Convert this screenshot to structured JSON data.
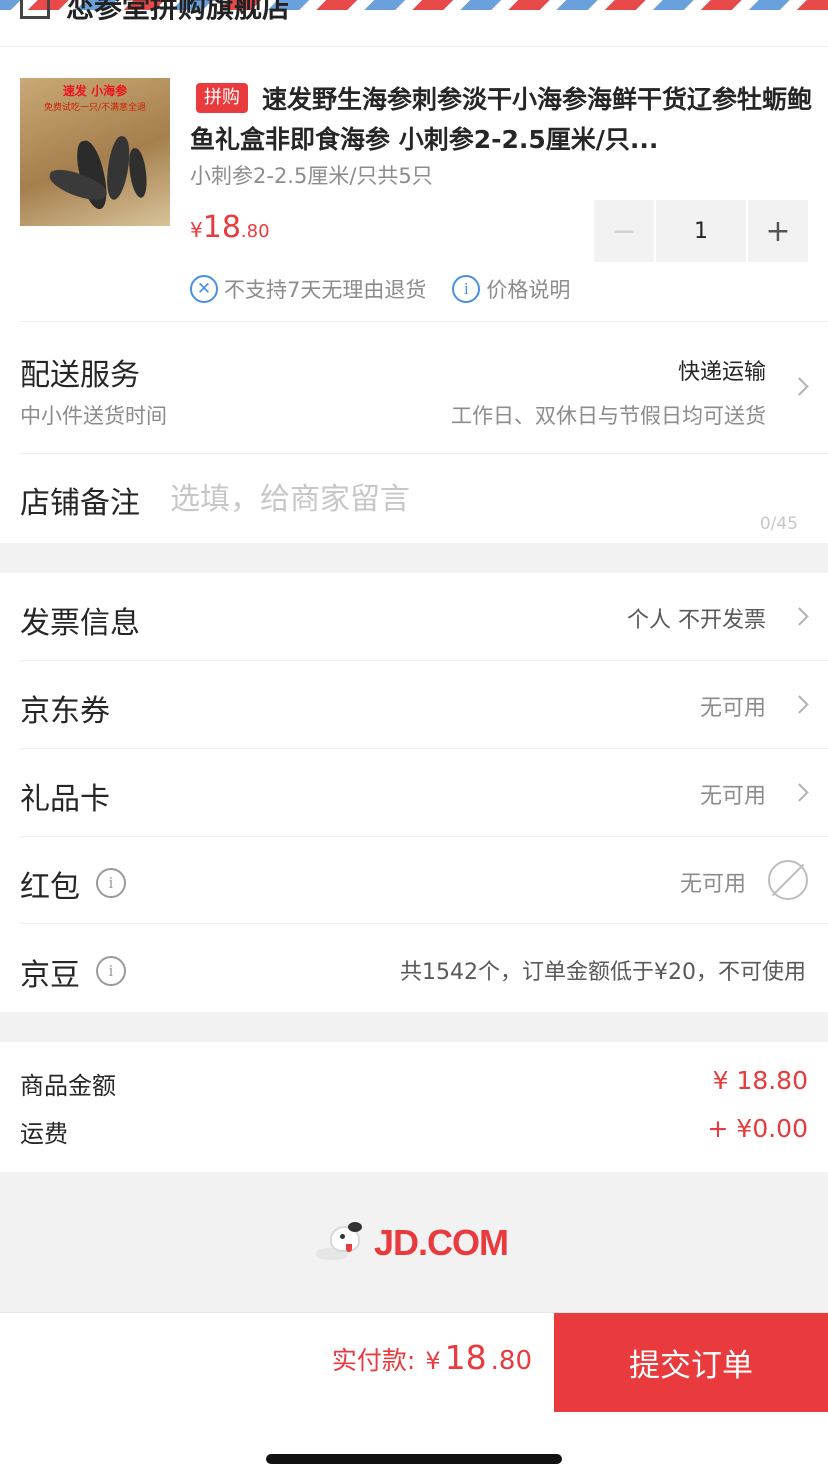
{
  "shop": {
    "name": "恋参堂拼购旗舰店"
  },
  "product": {
    "image_text": "速发 小海参",
    "image_subtext": "免费试吃一只/不满意全退",
    "badge": "拼购",
    "title": "速发野生海参刺参淡干小海参海鲜干货辽参牡蛎鲍鱼礼盒非即食海参 小刺参2-2.5厘米/只...",
    "spec": "小刺参2-2.5厘米/只共5只",
    "price": {
      "currency": "¥",
      "int": "18",
      "dec": ".80"
    },
    "quantity": "1",
    "minus_label": "−",
    "plus_label": "+",
    "no_return": "不支持7天无理由退货",
    "price_info": "价格说明"
  },
  "delivery": {
    "title": "配送服务",
    "subtitle": "中小件送货时间",
    "method": "快递运输",
    "schedule": "工作日、双休日与节假日均可送货"
  },
  "remark": {
    "label": "店铺备注",
    "placeholder": "选填，给商家留言",
    "counter": "0/45"
  },
  "options": [
    {
      "label": "发票信息",
      "value": "个人 不开发票"
    },
    {
      "label": "京东券",
      "value": "无可用"
    },
    {
      "label": "礼品卡",
      "value": "无可用"
    },
    {
      "label": "红包",
      "value": "无可用"
    },
    {
      "label": "京豆",
      "value": "共1542个，订单金额低于¥20，不可使用"
    }
  ],
  "summary": {
    "goods_label": "商品金额",
    "goods_value": "¥ 18.80",
    "freight_label": "运费",
    "freight_value": "+ ¥0.00"
  },
  "footer": {
    "logo_text": "JD.COM"
  },
  "checkout": {
    "pay_label": "实付款:",
    "currency": "¥",
    "int": "18",
    "dec": ".80",
    "submit_label": "提交订单"
  },
  "colors": {
    "accent": "#e93b3d",
    "info_blue": "#4a90e2"
  }
}
